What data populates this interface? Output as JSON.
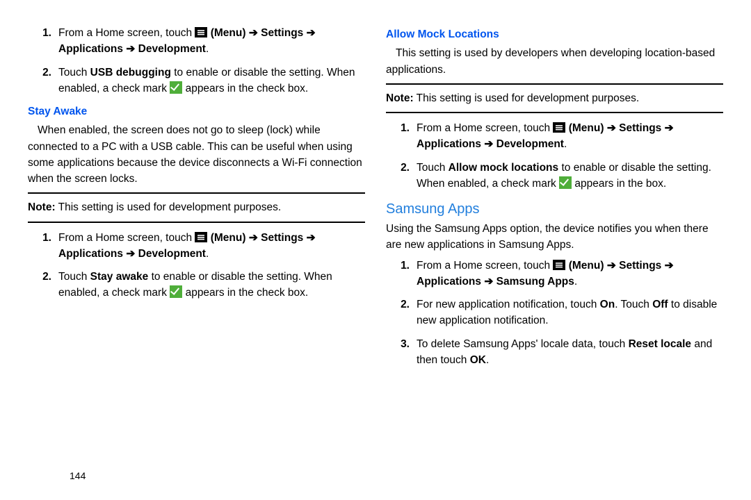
{
  "page_number": "144",
  "arrow": "➔",
  "left": {
    "steps_a": [
      {
        "n": "1.",
        "pre": "From a Home screen, touch ",
        "menu": " (Menu) ",
        "tail_b1": "Settings",
        "mid": " ",
        "tail_b2": "Applications",
        "mid2": " ",
        "tail_b3": "Development",
        "end": "."
      },
      {
        "n": "2.",
        "pre": "Touch ",
        "b": "USB debugging",
        "mid": " to enable or disable the setting. When enabled, a check mark ",
        "mid2": " appears in the check box."
      }
    ],
    "h_stay": "Stay Awake",
    "stay_body": "When enabled, the screen does not go to sleep (lock) while connected to a PC with a USB cable. This can be useful when using some applications because the device disconnects a Wi-Fi connection when the screen locks.",
    "note1_b": "Note:",
    "note1": " This setting is used for development purposes.",
    "steps_b": [
      {
        "n": "1.",
        "pre": "From a Home screen, touch ",
        "menu": " (Menu) ",
        "tail_b1": "Settings",
        "mid": " ",
        "tail_b2": "Applications",
        "mid2": " ",
        "tail_b3": "Development",
        "end": "."
      },
      {
        "n": "2.",
        "pre": "Touch ",
        "b": "Stay awake",
        "mid": " to enable or disable the setting. When enabled, a check mark ",
        "mid2": " appears in the check box."
      }
    ]
  },
  "right": {
    "h_mock": "Allow Mock Locations",
    "mock_body": "This setting is used by developers when developing location-based applications.",
    "note2_b": "Note:",
    "note2": " This setting is used for development purposes.",
    "steps_c": [
      {
        "n": "1.",
        "pre": "From a Home screen, touch ",
        "menu": " (Menu) ",
        "tail_b1": "Settings",
        "mid": " ",
        "tail_b2": "Applications",
        "mid2": " ",
        "tail_b3": "Development",
        "end": "."
      },
      {
        "n": "2.",
        "pre": "Touch ",
        "b": "Allow mock locations",
        "mid": " to enable or disable the setting. When enabled, a check mark ",
        "mid2": " appears in the box."
      }
    ],
    "h_samsung": "Samsung Apps",
    "samsung_body": "Using the Samsung Apps option, the device notifies you when there are new applications in Samsung Apps.",
    "steps_d": [
      {
        "n": "1.",
        "pre": "From a Home screen, touch ",
        "menu": " (Menu) ",
        "tail_b1": "Settings",
        "mid": " ",
        "tail_b2": "Applications",
        "mid2": " ",
        "tail_b3": "Samsung Apps",
        "end": "."
      },
      {
        "n": "2.",
        "pre": "For new application notification, touch ",
        "b": "On",
        "mid": ". Touch ",
        "b2": "Off",
        "mid2": " to disable new application notification."
      },
      {
        "n": "3.",
        "pre": "To delete Samsung Apps' locale data, touch ",
        "b": "Reset locale",
        "mid": " and then touch ",
        "b2": "OK",
        "mid2": "."
      }
    ]
  }
}
